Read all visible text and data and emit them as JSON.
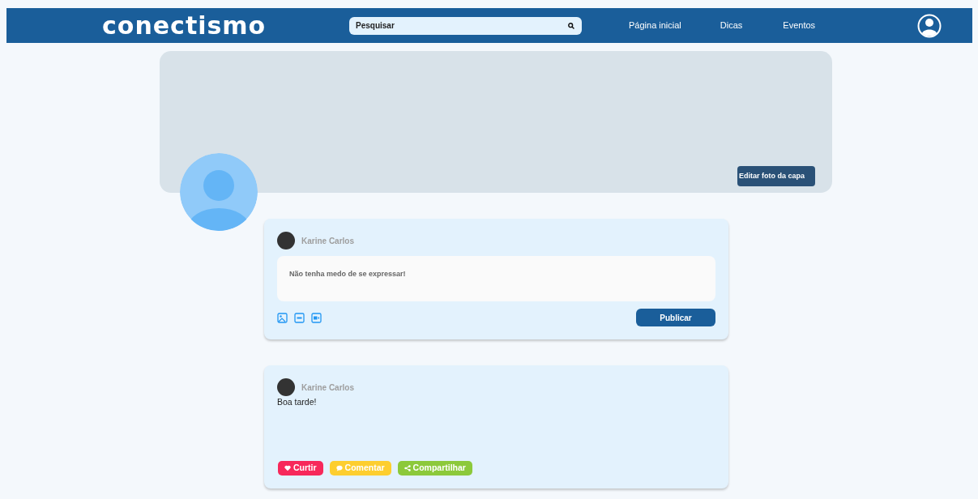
{
  "navbar": {
    "logo": "conectismo",
    "search": {
      "placeholder": "Pesquisar"
    },
    "links": [
      "Página inicial",
      "Dicas",
      "Eventos"
    ]
  },
  "cover": {
    "edit_button": "Editar foto da capa"
  },
  "composer": {
    "author": "Karine Carlos",
    "placeholder": "Não tenha medo de se expressar!",
    "publish_button": "Publicar"
  },
  "posts": [
    {
      "author": "Karine Carlos",
      "text": "Boa tarde!",
      "actions": [
        {
          "kind": "like",
          "label": "Curtir",
          "color": "#f7285a"
        },
        {
          "kind": "comment",
          "label": "Comentar",
          "color": "#fdce2f"
        },
        {
          "kind": "share",
          "label": "Compartilhar",
          "color": "#8cc93a"
        }
      ]
    }
  ]
}
